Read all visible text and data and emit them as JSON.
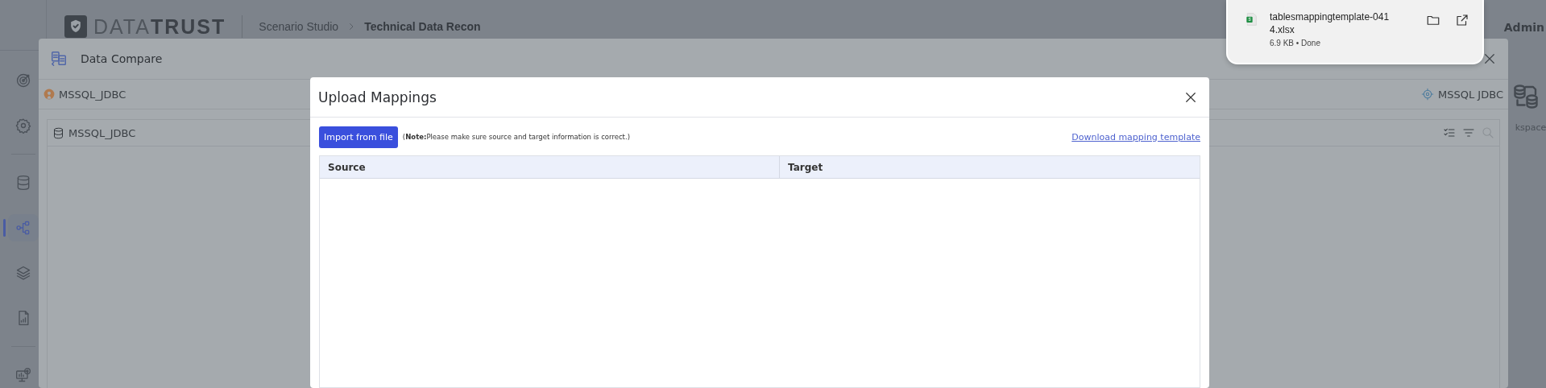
{
  "header": {
    "logo": {
      "part_1": "DATA",
      "part_2": "TRUST"
    },
    "breadcrumb": [
      {
        "label": "Scenario Studio",
        "current": false
      },
      {
        "label": "Technical Data Recon",
        "current": true
      }
    ],
    "user": "Admin"
  },
  "sidebar": {
    "groups": [
      [
        {
          "kind": "target",
          "selected": false
        },
        {
          "kind": "settings",
          "selected": false
        }
      ],
      [
        {
          "kind": "database",
          "selected": false
        },
        {
          "kind": "flow",
          "selected": true
        },
        {
          "kind": "layers",
          "selected": false
        },
        {
          "kind": "report",
          "selected": false
        }
      ],
      [
        {
          "kind": "monitor",
          "selected": false
        }
      ]
    ]
  },
  "side_panel": {
    "label": "kspace"
  },
  "window": {
    "title": "Data Compare",
    "source": "MSSQL_JDBC",
    "target": "MSSQL JDBC",
    "panel_title": "MSSQL_JDBC"
  },
  "modal": {
    "title": "Upload Mappings",
    "import_button": "Import from file",
    "note": "(**Note:**Please make sure source and target information is correct.)",
    "link": "Download mapping template",
    "table": {
      "columns": [
        "Source",
        "Target"
      ]
    }
  },
  "download": {
    "file_name_line_1": "tablesmappingtemplate-041",
    "file_name_line_2": "4.xlsx",
    "status": "6.9 KB • Done"
  }
}
